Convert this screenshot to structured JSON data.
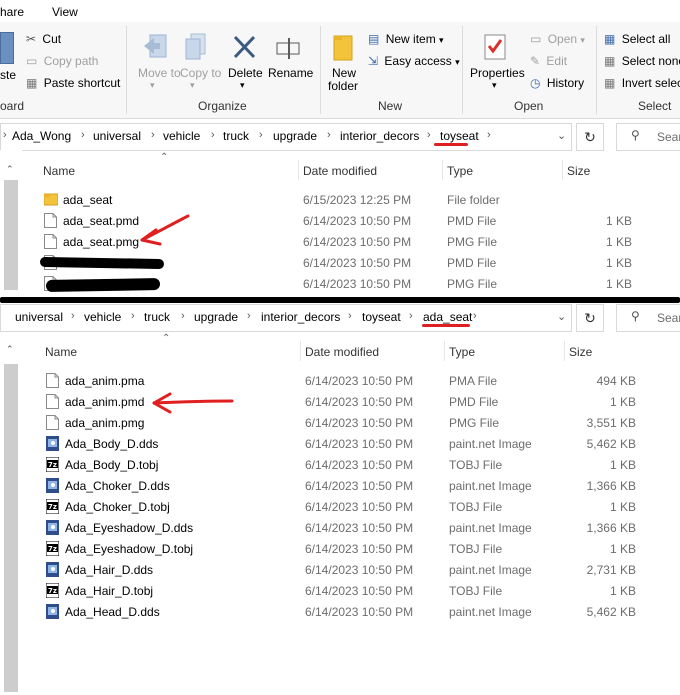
{
  "tabs": {
    "share": "hare",
    "view": "View"
  },
  "ribbon": {
    "clipboard": {
      "paste_label": "ste",
      "cut": "Cut",
      "copy_path": "Copy path",
      "paste_shortcut": "Paste shortcut",
      "group": "oard"
    },
    "organize": {
      "move_to": "Move to",
      "copy_to": "Copy to",
      "delete": "Delete",
      "rename": "Rename",
      "group": "Organize"
    },
    "new": {
      "new_folder_line1": "New",
      "new_folder_line2": "folder",
      "new_item": "New item",
      "easy_access": "Easy access",
      "group": "New"
    },
    "open": {
      "properties": "Properties",
      "open": "Open",
      "edit": "Edit",
      "history": "History",
      "group": "Open"
    },
    "select": {
      "select_all": "Select all",
      "select_none": "Select none",
      "invert_selection": "Invert selec",
      "group": "Select"
    }
  },
  "top_pane": {
    "breadcrumb": [
      "Ada_Wong",
      "universal",
      "vehicle",
      "truck",
      "upgrade",
      "interior_decors",
      "toyseat"
    ],
    "search_placeholder": "Sear",
    "columns": {
      "name": "Name",
      "date": "Date modified",
      "type": "Type",
      "size": "Size"
    },
    "rows": [
      {
        "name": "ada_seat",
        "date": "6/15/2023 12:25 PM",
        "type": "File folder",
        "size": "",
        "icon": "folder-icon"
      },
      {
        "name": "ada_seat.pmd",
        "date": "6/14/2023 10:50 PM",
        "type": "PMD File",
        "size": "1 KB",
        "icon": "file-icon"
      },
      {
        "name": "ada_seat.pmg",
        "date": "6/14/2023 10:50 PM",
        "type": "PMG File",
        "size": "1 KB",
        "icon": "file-icon"
      },
      {
        "name": "",
        "date": "6/14/2023 10:50 PM",
        "type": "PMD File",
        "size": "1 KB",
        "icon": "file-icon"
      },
      {
        "name": "",
        "date": "6/14/2023 10:50 PM",
        "type": "PMG File",
        "size": "1 KB",
        "icon": "file-icon"
      }
    ]
  },
  "bottom_pane": {
    "breadcrumb": [
      "universal",
      "vehicle",
      "truck",
      "upgrade",
      "interior_decors",
      "toyseat",
      "ada_seat"
    ],
    "search_placeholder": "Sear",
    "columns": {
      "name": "Name",
      "date": "Date modified",
      "type": "Type",
      "size": "Size"
    },
    "rows": [
      {
        "name": "ada_anim.pma",
        "date": "6/14/2023 10:50 PM",
        "type": "PMA File",
        "size": "494 KB",
        "icon": "file-icon"
      },
      {
        "name": "ada_anim.pmd",
        "date": "6/14/2023 10:50 PM",
        "type": "PMD File",
        "size": "1 KB",
        "icon": "file-icon"
      },
      {
        "name": "ada_anim.pmg",
        "date": "6/14/2023 10:50 PM",
        "type": "PMG File",
        "size": "3,551 KB",
        "icon": "file-icon"
      },
      {
        "name": "Ada_Body_D.dds",
        "date": "6/14/2023 10:50 PM",
        "type": "paint.net Image",
        "size": "5,462 KB",
        "icon": "image-icon"
      },
      {
        "name": "Ada_Body_D.tobj",
        "date": "6/14/2023 10:50 PM",
        "type": "TOBJ File",
        "size": "1 KB",
        "icon": "7z-icon"
      },
      {
        "name": "Ada_Choker_D.dds",
        "date": "6/14/2023 10:50 PM",
        "type": "paint.net Image",
        "size": "1,366 KB",
        "icon": "image-icon"
      },
      {
        "name": "Ada_Choker_D.tobj",
        "date": "6/14/2023 10:50 PM",
        "type": "TOBJ File",
        "size": "1 KB",
        "icon": "7z-icon"
      },
      {
        "name": "Ada_Eyeshadow_D.dds",
        "date": "6/14/2023 10:50 PM",
        "type": "paint.net Image",
        "size": "1,366 KB",
        "icon": "image-icon"
      },
      {
        "name": "Ada_Eyeshadow_D.tobj",
        "date": "6/14/2023 10:50 PM",
        "type": "TOBJ File",
        "size": "1 KB",
        "icon": "7z-icon"
      },
      {
        "name": "Ada_Hair_D.dds",
        "date": "6/14/2023 10:50 PM",
        "type": "paint.net Image",
        "size": "2,731 KB",
        "icon": "image-icon"
      },
      {
        "name": "Ada_Hair_D.tobj",
        "date": "6/14/2023 10:50 PM",
        "type": "TOBJ File",
        "size": "1 KB",
        "icon": "7z-icon"
      },
      {
        "name": "Ada_Head_D.dds",
        "date": "6/14/2023 10:50 PM",
        "type": "paint.net Image",
        "size": "5,462 KB",
        "icon": "image-icon"
      }
    ]
  },
  "colors": {
    "annotation": "#e02020",
    "accent": "#1e6ec8",
    "folder": "#f0c040"
  }
}
